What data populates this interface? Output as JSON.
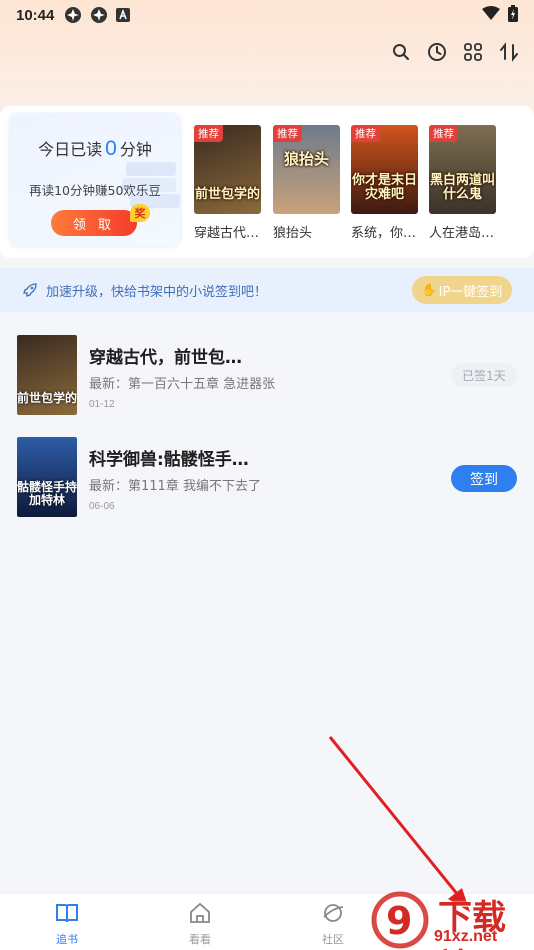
{
  "status_bar": {
    "time": "10:44",
    "icons": [
      "app-icon",
      "app-icon",
      "font-icon"
    ],
    "right_icons": [
      "wifi-icon",
      "battery-icon"
    ]
  },
  "toolbar": {
    "icons": [
      "search-icon",
      "history-icon",
      "grid-icon",
      "sort-icon"
    ]
  },
  "reading_card": {
    "prefix": "今日已读",
    "minutes": "0",
    "suffix": "分钟",
    "subtitle": "再读10分钟赚50欢乐豆",
    "claim_label": "领 取",
    "badge": "奖"
  },
  "recommended": [
    {
      "tag": "推荐",
      "name": "穿越古代…",
      "cover_text": "前世包学的",
      "colors": [
        "#3a2a1f",
        "#8b6b3c"
      ]
    },
    {
      "tag": "推荐",
      "name": "狼抬头",
      "cover_text": "狼抬头",
      "colors": [
        "#6e7b8a",
        "#c9a27a"
      ]
    },
    {
      "tag": "推荐",
      "name": "系统，你…",
      "cover_text": "你才是末日灾难吧",
      "colors": [
        "#3b1a10",
        "#d2551e"
      ]
    },
    {
      "tag": "推荐",
      "name": "人在港岛…",
      "cover_text": "黑白两道叫什么鬼",
      "colors": [
        "#3a3328",
        "#7e6e52"
      ]
    }
  ],
  "sign_banner": {
    "text": "加速升级，快给书架中的小说签到吧！",
    "button_label": "IP一键签到"
  },
  "shelf": [
    {
      "title": "穿越古代，前世包…",
      "latest": "最新：第一百六十五章 急进器张",
      "date": "01-12",
      "status": "已签1天",
      "signed": true,
      "cover_text": "前世包学的",
      "colors": [
        "#3a2a1f",
        "#8b6b3c"
      ]
    },
    {
      "title": "科学御兽:骷髅怪手…",
      "latest": "最新：第111章 我编不下去了",
      "date": "06-06",
      "status": "签到",
      "signed": false,
      "cover_text": "骷髅怪手持加特林",
      "colors": [
        "#0d1a3a",
        "#2e5da8"
      ]
    }
  ],
  "bottom_nav": [
    {
      "label": "追书",
      "icon": "book-icon",
      "active": true
    },
    {
      "label": "看看",
      "icon": "home-icon",
      "active": false
    },
    {
      "label": "社区",
      "icon": "planet-icon",
      "active": false
    }
  ],
  "watermark": {
    "text": "下载站",
    "url": "91xz.net",
    "logo_text": "9"
  },
  "colors": {
    "accent": "#2e7ff0",
    "claim": "#f43c2c",
    "tag": "#e2413b",
    "annotation": "#e02020"
  }
}
